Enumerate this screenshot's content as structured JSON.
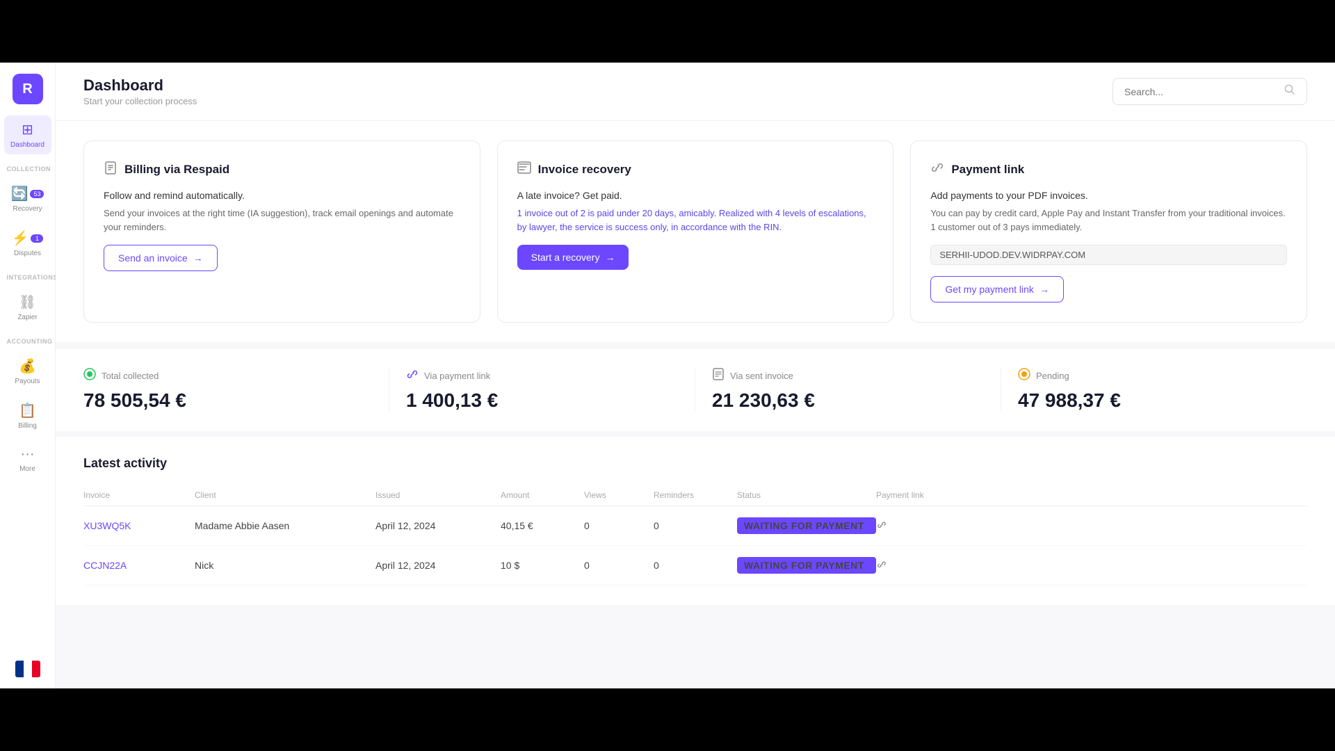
{
  "app": {
    "logo_letter": "R",
    "accent_color": "#6c47ff"
  },
  "sidebar": {
    "collection_label": "COLLECTION",
    "integrations_label": "INTEGRATIONS",
    "accounting_label": "ACCOUNTING",
    "items": [
      {
        "id": "dashboard",
        "label": "Dashboard",
        "icon": "⊞",
        "active": true
      },
      {
        "id": "recovery",
        "label": "Recovery",
        "icon": "🔄",
        "active": false,
        "badge": "53"
      },
      {
        "id": "disputes",
        "label": "Disputes",
        "icon": "⚡",
        "active": false,
        "badge": "1"
      },
      {
        "id": "zapier",
        "label": "Zapier",
        "icon": "⛓",
        "active": false
      },
      {
        "id": "payouts",
        "label": "Payouts",
        "icon": "💰",
        "active": false
      },
      {
        "id": "billing",
        "label": "Billing",
        "icon": "📋",
        "active": false
      },
      {
        "id": "more",
        "label": "More",
        "icon": "···",
        "active": false
      }
    ]
  },
  "header": {
    "title": "Dashboard",
    "subtitle": "Start your collection process",
    "search_placeholder": "Search..."
  },
  "cards": [
    {
      "id": "billing",
      "icon": "📄",
      "title": "Billing via Respaid",
      "tagline": "Follow and remind automatically.",
      "description": "Send your invoices at the right time (IA suggestion), track email openings and automate your reminders.",
      "button_label": "Send an invoice",
      "button_type": "outline"
    },
    {
      "id": "recovery",
      "icon": "📁",
      "title": "Invoice recovery",
      "tagline": "A late invoice? Get paid.",
      "description": "1 invoice out of 2 is paid under 20 days, amicably. Realized with 4 levels of escalations, by lawyer, the service is success only, in accordance with the RIN.",
      "button_label": "Start a recovery",
      "button_type": "solid"
    },
    {
      "id": "payment",
      "icon": "🔗",
      "title": "Payment link",
      "tagline": "Add payments to your PDF invoices.",
      "description": "You can pay by credit card, Apple Pay and Instant Transfer from your traditional invoices. 1 customer out of 3 pays immediately.",
      "url": "SERHII-UDOD.DEV.WIDRPAY.COM",
      "button_label": "Get my payment link",
      "button_type": "outline"
    }
  ],
  "stats": [
    {
      "id": "total_collected",
      "icon": "🟢",
      "label": "Total collected",
      "value": "78 505,54 €"
    },
    {
      "id": "via_payment_link",
      "icon": "🔗",
      "label": "Via payment link",
      "value": "1 400,13 €"
    },
    {
      "id": "via_sent_invoice",
      "icon": "📋",
      "label": "Via sent invoice",
      "value": "21 230,63 €"
    },
    {
      "id": "pending",
      "icon": "🟡",
      "label": "Pending",
      "value": "47 988,37 €"
    }
  ],
  "activity": {
    "title": "Latest activity",
    "columns": [
      "Invoice",
      "Client",
      "Issued",
      "Amount",
      "Views",
      "Reminders",
      "Status",
      "Payment link"
    ],
    "rows": [
      {
        "invoice": "XU3WQ5K",
        "client": "Madame Abbie Aasen",
        "issued": "April 12, 2024",
        "amount": "40,15 €",
        "views": "0",
        "reminders": "0",
        "status": "WAITING FOR PAYMENT",
        "has_link": true
      },
      {
        "invoice": "CCJN22A",
        "client": "Nick",
        "issued": "April 12, 2024",
        "amount": "10 $",
        "views": "0",
        "reminders": "0",
        "status": "WAITING FOR PAYMENT",
        "has_link": true
      }
    ]
  }
}
